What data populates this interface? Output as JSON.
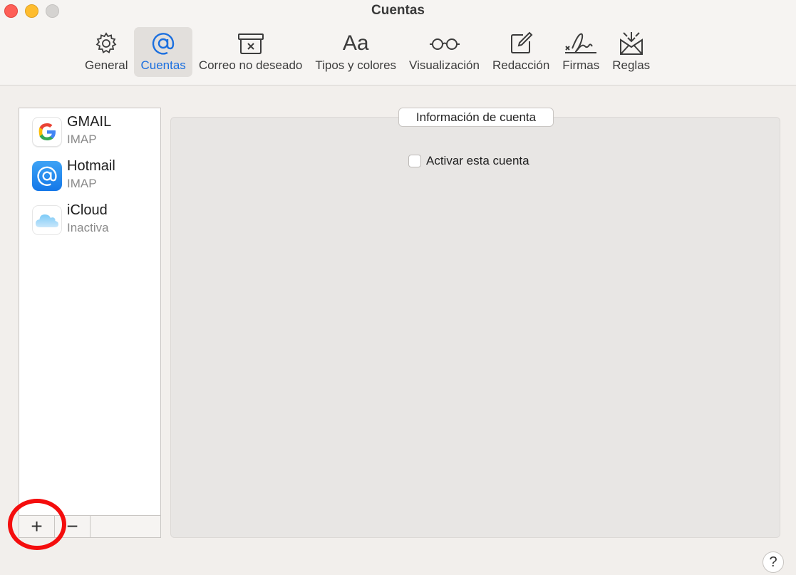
{
  "window": {
    "title": "Cuentas"
  },
  "toolbar": {
    "items": [
      {
        "label": "General",
        "icon": "gear-icon",
        "active": false
      },
      {
        "label": "Cuentas",
        "icon": "at-icon",
        "active": true
      },
      {
        "label": "Correo no deseado",
        "icon": "junk-bin-icon",
        "active": false
      },
      {
        "label": "Tipos y colores",
        "icon": "font-icon",
        "active": false,
        "glyph": "Aa"
      },
      {
        "label": "Visualización",
        "icon": "glasses-icon",
        "active": false
      },
      {
        "label": "Redacción",
        "icon": "compose-icon",
        "active": false
      },
      {
        "label": "Firmas",
        "icon": "signature-icon",
        "active": false
      },
      {
        "label": "Reglas",
        "icon": "rules-envelope-icon",
        "active": false
      }
    ]
  },
  "accounts": [
    {
      "name": "GMAIL",
      "type": "IMAP",
      "icon": "google-icon"
    },
    {
      "name": "Hotmail",
      "type": "IMAP",
      "icon": "hotmail-icon"
    },
    {
      "name": "iCloud",
      "type": "Inactiva",
      "icon": "icloud-icon"
    }
  ],
  "list_footer": {
    "add_label": "+",
    "remove_label": "−"
  },
  "panel": {
    "tab_label": "Información de cuenta",
    "activate_label": "Activar esta cuenta",
    "activate_checked": false
  },
  "help": {
    "label": "?"
  },
  "colors": {
    "accent": "#1b6fdf",
    "highlight": "#f40d0d"
  }
}
